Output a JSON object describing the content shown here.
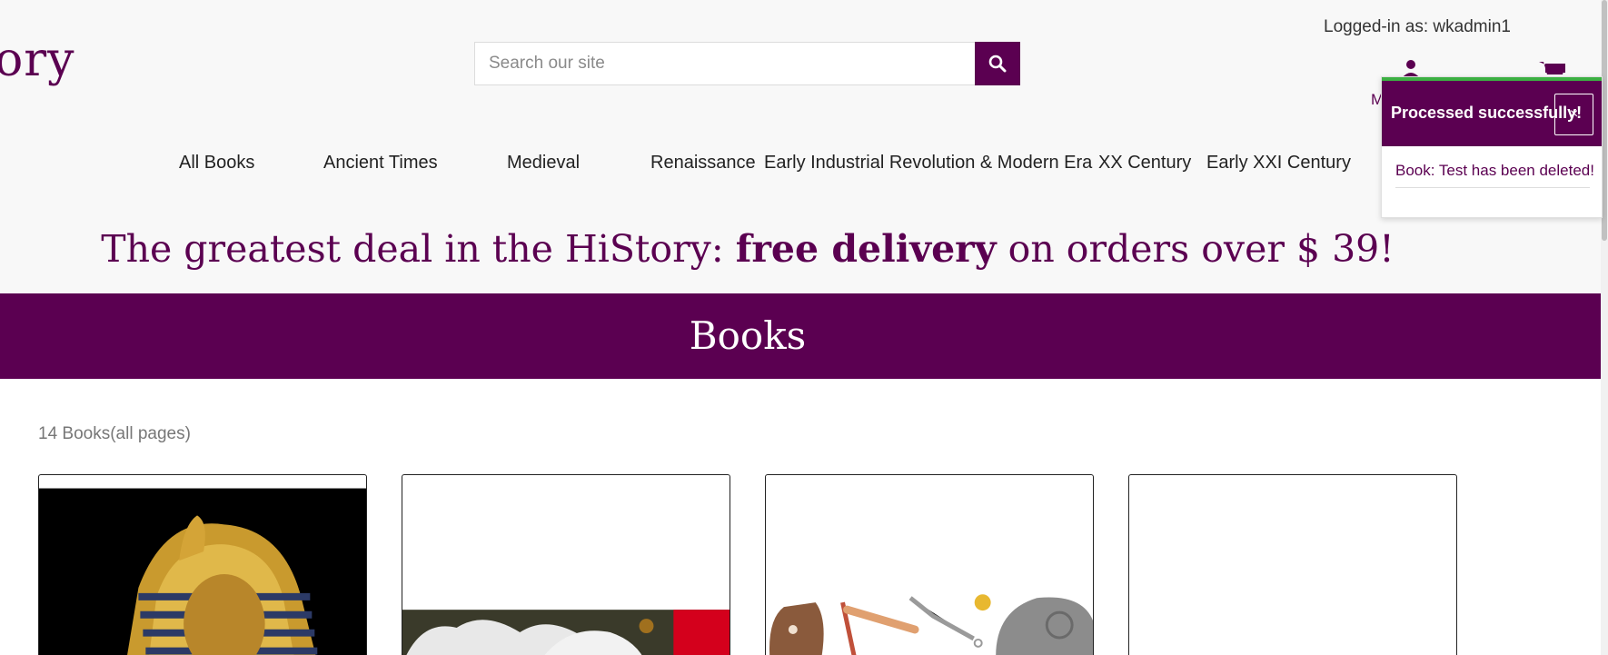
{
  "header": {
    "logo_text": "ory",
    "search_placeholder": "Search our site",
    "logged_in": "Logged-in as: wkadmin1",
    "account_label": "M"
  },
  "nav": {
    "items": [
      "All Books",
      "Ancient Times",
      "Medieval",
      "Renaissance",
      "Early Industrial Revolution & Modern Era",
      "XX Century",
      "Early XXI Century"
    ]
  },
  "promo": {
    "before": "The greatest deal in the HiStory: ",
    "bold": "free delivery",
    "after": " on orders over $ 39!"
  },
  "banner": {
    "title": "Books"
  },
  "listing": {
    "count_text": "14 Books(all pages)"
  },
  "toast": {
    "title": "Processed successfully!",
    "close": "×",
    "message": "Book: Test has been deleted!"
  },
  "colors": {
    "brand": "#5b0051",
    "success_accent": "#3cb043",
    "header_bg": "#f8f8f8"
  },
  "icons": [
    "search-icon",
    "account-icon",
    "cart-icon",
    "close-icon"
  ]
}
